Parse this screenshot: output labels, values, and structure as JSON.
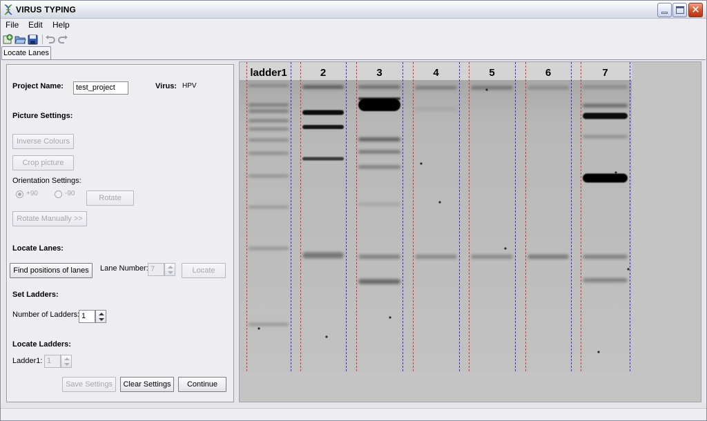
{
  "window": {
    "title": "VIRUS TYPING",
    "icon": "dna-app-icon"
  },
  "menu": {
    "file": "File",
    "edit": "Edit",
    "help": "Help"
  },
  "toolbar": {
    "icons": [
      "new-project-icon",
      "open-icon",
      "save-icon",
      "undo-icon",
      "redo-icon"
    ]
  },
  "tabs": {
    "active": "Locate Lanes"
  },
  "project": {
    "name_label": "Project Name:",
    "name_value": "test_project",
    "virus_label": "Virus:",
    "virus_value": "HPV"
  },
  "picture_settings": {
    "heading": "Picture Settings:",
    "inverse_colours": "Inverse Colours",
    "crop_picture": "Crop picture",
    "orientation_label": "Orientation Settings:",
    "option_plus90": "+90",
    "option_minus90": "-90",
    "selected_orientation": "+90",
    "rotate": "Rotate",
    "rotate_manually": "Rotate Manually >>"
  },
  "locate_lanes": {
    "heading": "Locate Lanes:",
    "find_positions": "Find positions of lanes",
    "lane_number_label": "Lane Number:",
    "lane_number_value": "7",
    "locate": "Locate"
  },
  "set_ladders": {
    "heading": "Set Ladders:",
    "number_label": "Number of Ladders:",
    "number_value": "1"
  },
  "locate_ladders": {
    "heading": "Locate Ladders:",
    "ladder1_label": "Ladder1:",
    "ladder1_value": "1"
  },
  "actions": {
    "save_settings": "Save Settings",
    "clear_settings": "Clear Settings",
    "continue": "Continue"
  },
  "gel": {
    "lane_labels": [
      "ladder1",
      "2",
      "3",
      "4",
      "5",
      "6",
      "7"
    ],
    "lane_start_color": "#e03030",
    "lane_end_color": "#3030e0",
    "background_color": "#c4c4c4"
  }
}
